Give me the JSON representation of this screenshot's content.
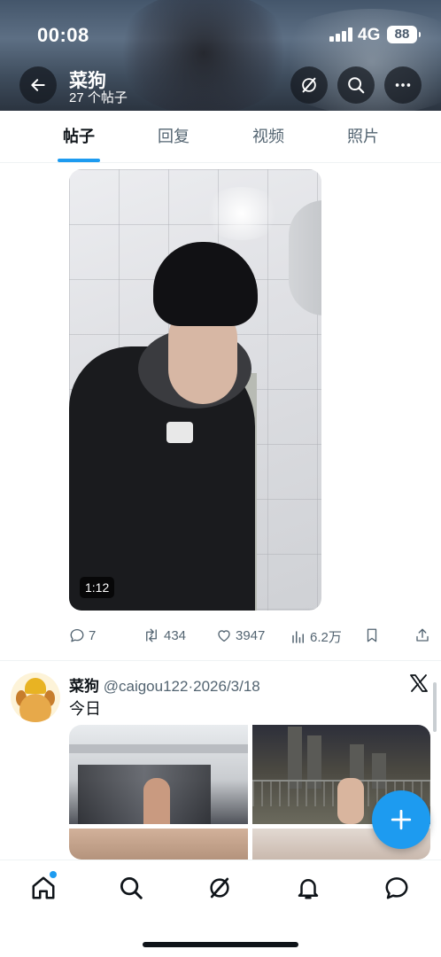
{
  "status_bar": {
    "time": "00:08",
    "network": "4G",
    "battery": "88"
  },
  "header": {
    "title": "菜狗",
    "subtitle": "27 个帖子"
  },
  "tabs": [
    {
      "label": "帖子",
      "active": true
    },
    {
      "label": "回复",
      "active": false
    },
    {
      "label": "视频",
      "active": false
    },
    {
      "label": "照片",
      "active": false
    }
  ],
  "post1": {
    "video_duration": "1:12",
    "replies": "7",
    "reposts": "434",
    "likes": "3947",
    "views": "6.2万"
  },
  "post2": {
    "name": "菜狗",
    "handle": "@caigou122",
    "separator": "·",
    "date": "2026/3/18",
    "text": "今日"
  },
  "colors": {
    "accent": "#1d9bf0",
    "text": "#0f1419",
    "muted": "#536471"
  },
  "icons": [
    "back-arrow-icon",
    "grok-icon",
    "search-icon",
    "more-icon",
    "reply-icon",
    "repost-icon",
    "like-icon",
    "views-icon",
    "bookmark-icon",
    "share-icon",
    "x-logo-icon",
    "compose-icon",
    "home-icon",
    "explore-icon",
    "grok-nav-icon",
    "notifications-icon",
    "messages-icon"
  ]
}
